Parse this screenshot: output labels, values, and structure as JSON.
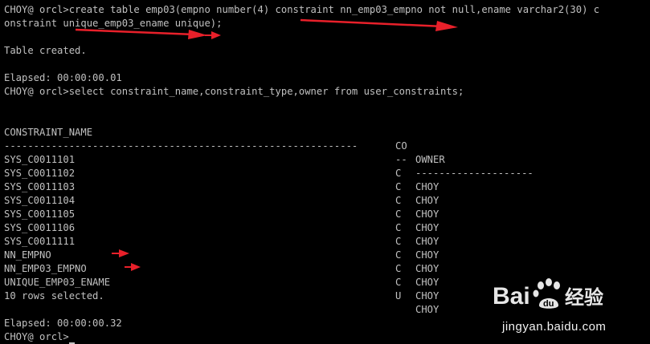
{
  "terminal": {
    "lines": {
      "cmd1_a": "CHOY@ orcl>create table emp03(empno number(4) constraint nn_emp03_empno not null,ename varchar2(30) c",
      "cmd1_b": "onstraint unique_emp03_ename unique);",
      "blank1": "",
      "table_created": "Table created.",
      "blank2": "",
      "elapsed1": "Elapsed: 00:00:00.01",
      "cmd2": "CHOY@ orcl>select constraint_name,constraint_type,owner from user_constraints;",
      "blank3": "",
      "blank4": "",
      "rows_selected": "10 rows selected.",
      "blank5": "",
      "elapsed2": "Elapsed: 00:00:00.32",
      "prompt": "CHOY@ orcl>"
    },
    "result": {
      "headers": {
        "name": "CONSTRAINT_NAME",
        "type": "CO",
        "owner": "OWNER"
      },
      "separators": {
        "name": "------------------------------------------------------------",
        "type": "--",
        "owner": "--------------------"
      },
      "rows": [
        {
          "name": "SYS_C0011101",
          "type": "C",
          "owner": "CHOY"
        },
        {
          "name": "SYS_C0011102",
          "type": "C",
          "owner": "CHOY"
        },
        {
          "name": "SYS_C0011103",
          "type": "C",
          "owner": "CHOY"
        },
        {
          "name": "SYS_C0011104",
          "type": "C",
          "owner": "CHOY"
        },
        {
          "name": "SYS_C0011105",
          "type": "C",
          "owner": "CHOY"
        },
        {
          "name": "SYS_C0011106",
          "type": "C",
          "owner": "CHOY"
        },
        {
          "name": "SYS_C0011111",
          "type": "C",
          "owner": "CHOY"
        },
        {
          "name": "NN_EMPNO",
          "type": "C",
          "owner": "CHOY"
        },
        {
          "name": "NN_EMP03_EMPNO",
          "type": "C",
          "owner": "CHOY"
        },
        {
          "name": "UNIQUE_EMP03_ENAME",
          "type": "U",
          "owner": "CHOY"
        }
      ]
    }
  },
  "watermark": {
    "brand": "Bai du 经验",
    "url": "jingyan.baidu.com"
  },
  "colors": {
    "background": "#000000",
    "text": "#c0c0c0",
    "arrow": "#e8202a"
  }
}
